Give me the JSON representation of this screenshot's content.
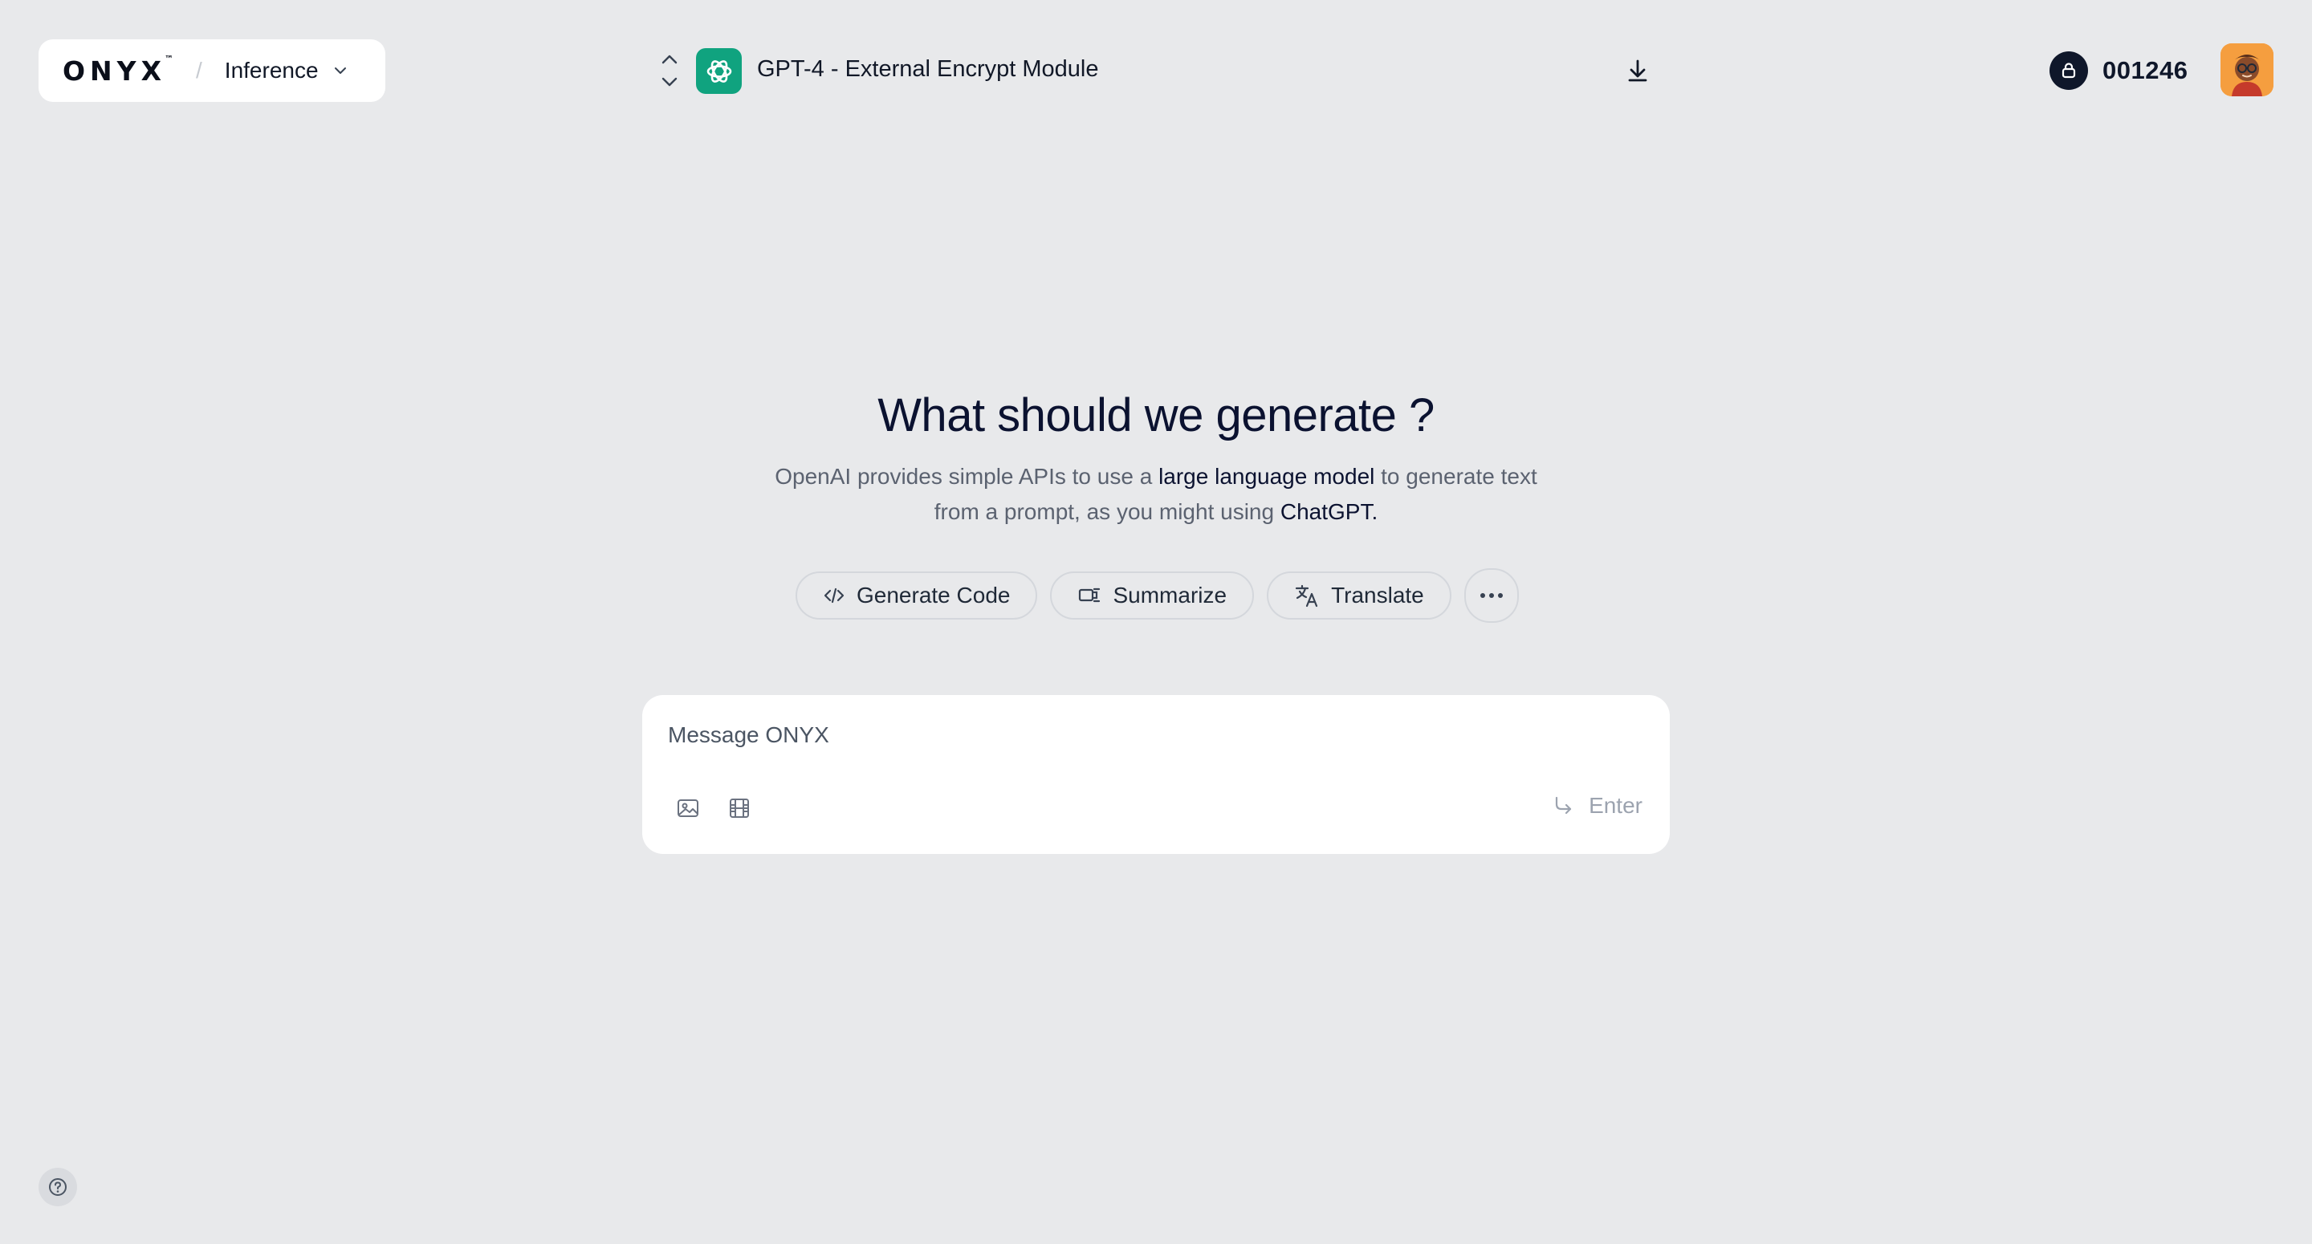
{
  "brand": {
    "logo_text": "ONYX",
    "trademark": "™",
    "separator": "/",
    "workspace": "Inference"
  },
  "model": {
    "name": "GPT-4 - External Encrypt Module",
    "logo_icon": "openai-icon",
    "accent_color": "#10a37f"
  },
  "credits": {
    "value": "001246",
    "icon": "lock-icon"
  },
  "hero": {
    "title": "What should we generate ?",
    "subtitle_part1": "OpenAI provides simple APIs to use a ",
    "subtitle_highlight1": "large language model",
    "subtitle_part2": " to generate text from a prompt, as you might using ",
    "subtitle_highlight2": "ChatGPT."
  },
  "chips": [
    {
      "label": "Generate Code",
      "icon": "code-icon"
    },
    {
      "label": "Summarize",
      "icon": "summarize-icon"
    },
    {
      "label": "Translate",
      "icon": "translate-icon"
    },
    {
      "label": "",
      "icon": "more-horizontal-icon"
    }
  ],
  "composer": {
    "placeholder": "Message ONYX",
    "send_label": "Enter"
  },
  "colors": {
    "background": "#e8e9eb",
    "surface": "#ffffff",
    "text_primary": "#0b1230",
    "text_muted": "#5b6270"
  }
}
